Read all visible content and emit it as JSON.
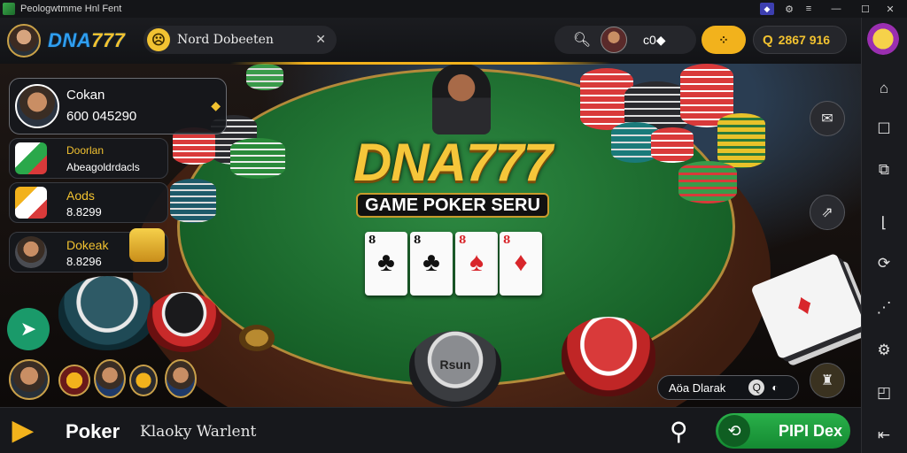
{
  "titlebar": {
    "title": "Peologwtmme  Hnl  Fent",
    "controls": {
      "account": "◆",
      "settings": "⚙",
      "menu": "≡",
      "minimize": "—",
      "maximize": "☐",
      "close": "✕"
    }
  },
  "header": {
    "logo_blue": "DNA",
    "logo_gold": "777",
    "search_text": "Nord Dobeeten",
    "chips_label": "c0◆",
    "gold_pill": "⁘",
    "balance": "2867 916"
  },
  "game": {
    "title_main": "DNA777",
    "title_sub": "GAME POKER SERU",
    "cards": [
      {
        "rank": "8",
        "suit": "♣",
        "color": "black"
      },
      {
        "rank": "8",
        "suit": "♣",
        "color": "black"
      },
      {
        "rank": "8",
        "suit": "♠",
        "color": "red"
      },
      {
        "rank": "8",
        "suit": "♦",
        "color": "red"
      }
    ],
    "center_chip_label": "Rsun",
    "chat_text": "Aöa Dlarak",
    "chat_badge": "Q"
  },
  "players": [
    {
      "name": "Cokan",
      "value": "600 045290"
    },
    {
      "name": "Doorlan",
      "value": "Abeagoldrdacls"
    },
    {
      "name": "Aods",
      "value": "8.8299"
    },
    {
      "name": "Dokeak",
      "value": "8.8296"
    }
  ],
  "bottom": {
    "app_name": "Poker",
    "subtitle": "Klaoky Warlent",
    "cta": "PIPI Dex"
  },
  "colors": {
    "accent_gold": "#f2b21c",
    "logo_blue": "#2f9ef0",
    "felt_green": "#1d7a34",
    "cta_green": "#22a444"
  }
}
